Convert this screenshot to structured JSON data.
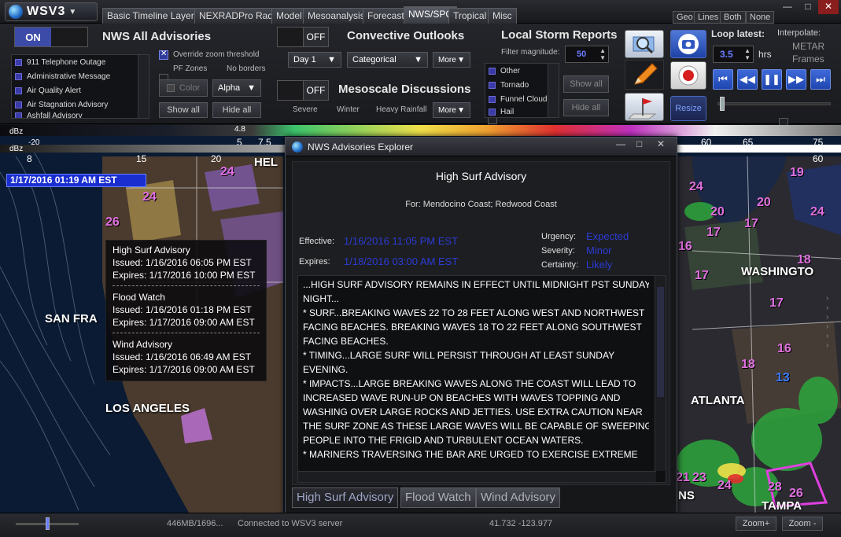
{
  "app": {
    "name": "WSV3"
  },
  "tabs": [
    "Basic Timeline Layers",
    "NEXRADPro Radar",
    "Model",
    "Mesoanalysis",
    "Forecast",
    "NWS/SPC",
    "Tropical",
    "Misc"
  ],
  "view_buttons": [
    "Geo",
    "Lines",
    "Both",
    "None"
  ],
  "window_buttons": {
    "minimize": "—",
    "maximize": "□",
    "close": "✕"
  },
  "nws": {
    "toggle_on": "ON",
    "title": "NWS All Advisories",
    "items": [
      "911 Telephone Outage",
      "Administrative Message",
      "Air Quality Alert",
      "Air Stagnation Advisory",
      "Ashfall Advisory"
    ],
    "override_zoom": "Override zoom threshold",
    "pf_zones": "PF Zones",
    "no_borders": "No borders",
    "color_btn": "Color",
    "alpha_dd": "Alpha",
    "show_all": "Show all",
    "hide_all": "Hide all"
  },
  "convective": {
    "toggle_off": "OFF",
    "title": "Convective Outlooks",
    "day_dd": "Day 1",
    "cat_dd": "Categorical",
    "more": "More"
  },
  "meso": {
    "toggle_off": "OFF",
    "title": "Mesoscale Discussions",
    "severe": "Severe",
    "winter": "Winter",
    "heavy_rain": "Heavy Rainfall",
    "more": "More"
  },
  "lsr": {
    "title": "Local Storm Reports",
    "filter": "Filter magnitude:",
    "filter_val": "50",
    "items": [
      "Other",
      "Tornado",
      "Funnel Cloud",
      "Hail"
    ],
    "show_all": "Show all",
    "hide_all": "Hide all"
  },
  "tools": {
    "resize": "Resize"
  },
  "loop": {
    "label": "Loop latest:",
    "hours_val": "3.5",
    "hours_unit": "hrs",
    "interpolate": "Interpolate:",
    "metar": "METAR",
    "frames": "Frames"
  },
  "legend": {
    "top_unit": "dBz",
    "top_ticks": [
      "-20",
      "4.8",
      "5",
      "7.5",
      "60",
      "65",
      "75"
    ],
    "bot_unit": "dBz",
    "bot_ticks": [
      "8",
      "15",
      "20",
      "60"
    ]
  },
  "map": {
    "datetime": "1/17/2016 01:19 AM EST",
    "cities": [
      "HEL",
      "SAN FRA",
      "LOS ANGELES",
      "WASHINGTO",
      "ATLANTA",
      "TAMPA",
      "NS"
    ],
    "temps": [
      "24",
      "24",
      "26",
      "24",
      "20",
      "20",
      "24",
      "17",
      "17",
      "16",
      "17",
      "18",
      "17",
      "16",
      "18",
      "13",
      "21",
      "23",
      "24",
      "28",
      "26",
      "19",
      "17",
      "16"
    ]
  },
  "tooltip": {
    "entries": [
      {
        "title": "High Surf Advisory",
        "issued": "Issued: 1/16/2016 06:05 PM EST",
        "expires": "Expires: 1/17/2016 10:00 PM EST"
      },
      {
        "title": "Flood Watch",
        "issued": "Issued: 1/16/2016 01:18 PM EST",
        "expires": "Expires: 1/17/2016 09:00 AM EST"
      },
      {
        "title": "Wind Advisory",
        "issued": "Issued: 1/16/2016 06:49 AM EST",
        "expires": "Expires: 1/17/2016 09:00 AM EST"
      }
    ]
  },
  "dialog": {
    "title": "NWS Advisories Explorer",
    "heading": "High Surf Advisory",
    "for": "For: Mendocino Coast; Redwood Coast",
    "effective_label": "Effective:",
    "effective": "1/16/2016 11:05 PM EST",
    "expires_label": "Expires:",
    "expires": "1/18/2016 03:00 AM EST",
    "urgency_label": "Urgency:",
    "urgency": "Expected",
    "severity_label": "Severity:",
    "severity": "Minor",
    "certainty_label": "Certainty:",
    "certainty": "Likely",
    "text_lines": [
      "...HIGH SURF ADVISORY REMAINS IN EFFECT UNTIL MIDNIGHT PST SUNDAY",
      "NIGHT...",
      "* SURF...BREAKING WAVES 22 TO 28 FEET ALONG WEST AND NORTHWEST",
      "FACING BEACHES. BREAKING WAVES 18 TO 22 FEET ALONG SOUTHWEST",
      "FACING BEACHES.",
      "* TIMING...LARGE SURF WILL PERSIST THROUGH AT LEAST SUNDAY",
      "EVENING.",
      "* IMPACTS...LARGE BREAKING WAVES ALONG THE COAST WILL LEAD TO",
      "INCREASED WAVE RUN-UP ON BEACHES WITH WAVES TOPPING AND",
      "WASHING OVER LARGE ROCKS AND JETTIES. USE EXTRA CAUTION NEAR",
      "THE SURF ZONE AS THESE LARGE WAVES WILL BE CAPABLE OF SWEEPING",
      "PEOPLE INTO THE FRIGID AND TURBULENT OCEAN WATERS.",
      "* MARINERS TRAVERSING THE BAR ARE URGED TO EXERCISE EXTREME"
    ],
    "tabs": [
      "High Surf Advisory",
      "Flood Watch",
      "Wind Advisory"
    ]
  },
  "status": {
    "memory": "446MB/1696...",
    "connection": "Connected to WSV3 server",
    "coords": "41.732 -123.977",
    "zoom_in": "Zoom+",
    "zoom_out": "Zoom -"
  },
  "colors": {
    "accent": "#3c4aa8",
    "link_blue": "#2b3bd6",
    "temp_magenta": "#e070e0"
  }
}
